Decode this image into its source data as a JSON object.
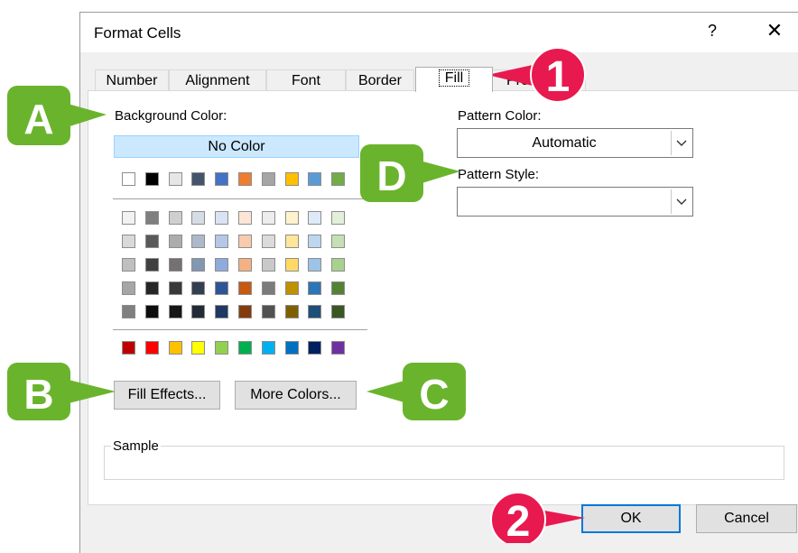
{
  "dialog": {
    "title": "Format Cells",
    "help_label": "?",
    "close_label": "✕"
  },
  "tabs": [
    {
      "label": "Number"
    },
    {
      "label": "Alignment"
    },
    {
      "label": "Font"
    },
    {
      "label": "Border"
    },
    {
      "label": "Fill"
    },
    {
      "label": "Protection"
    }
  ],
  "fill": {
    "background_color_label": "Background Color:",
    "no_color_label": "No Color",
    "theme_colors": [
      "#ffffff",
      "#000000",
      "#e7e6e6",
      "#44546a",
      "#4472c4",
      "#ed7d31",
      "#a5a5a5",
      "#ffc000",
      "#5b9bd5",
      "#70ad47"
    ],
    "tint_rows": [
      [
        "#f2f2f2",
        "#7f7f7f",
        "#d0cece",
        "#d6dce5",
        "#dae3f3",
        "#fbe5d6",
        "#ededed",
        "#fff2cc",
        "#deebf7",
        "#e2f0d9"
      ],
      [
        "#d9d9d9",
        "#595959",
        "#aeabab",
        "#adb9ca",
        "#b4c7e7",
        "#f8cbad",
        "#dbdbdb",
        "#ffe699",
        "#bdd7ee",
        "#c5e0b4"
      ],
      [
        "#bfbfbf",
        "#404040",
        "#757171",
        "#8497b0",
        "#8faadc",
        "#f4b183",
        "#c9c9c9",
        "#ffd966",
        "#9dc3e6",
        "#a9d18e"
      ],
      [
        "#a6a6a6",
        "#262626",
        "#3a3838",
        "#333f50",
        "#2f5597",
        "#c55a11",
        "#7b7b7b",
        "#bf9000",
        "#2e75b6",
        "#548235"
      ],
      [
        "#808080",
        "#0d0d0d",
        "#171616",
        "#222a35",
        "#203864",
        "#843c0c",
        "#525252",
        "#7f6000",
        "#1f4e79",
        "#385723"
      ]
    ],
    "standard_colors": [
      "#c00000",
      "#ff0000",
      "#ffc000",
      "#ffff00",
      "#92d050",
      "#00b050",
      "#00b0f0",
      "#0070c0",
      "#002060",
      "#7030a0"
    ],
    "fill_effects_label": "Fill Effects...",
    "more_colors_label": "More Colors...",
    "pattern_color_label": "Pattern Color:",
    "pattern_color_value": "Automatic",
    "pattern_style_label": "Pattern Style:",
    "pattern_style_value": "",
    "sample_label": "Sample"
  },
  "footer": {
    "ok_label": "OK",
    "cancel_label": "Cancel"
  },
  "callouts": {
    "a": "A",
    "b": "B",
    "c": "C",
    "d": "D",
    "one": "1",
    "two": "2",
    "green": "#6ab42d",
    "red": "#e8194f"
  }
}
